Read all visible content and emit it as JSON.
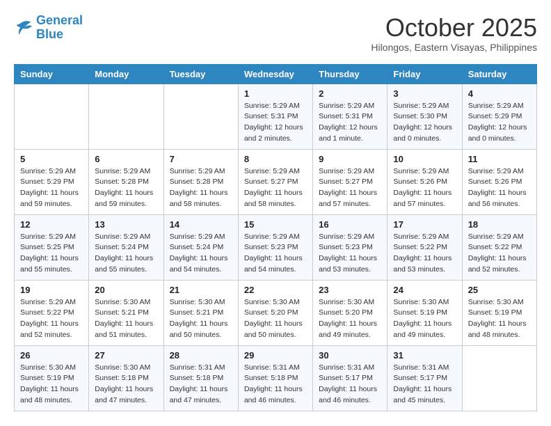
{
  "logo": {
    "line1": "General",
    "line2": "Blue"
  },
  "title": "October 2025",
  "location": "Hilongos, Eastern Visayas, Philippines",
  "days_of_week": [
    "Sunday",
    "Monday",
    "Tuesday",
    "Wednesday",
    "Thursday",
    "Friday",
    "Saturday"
  ],
  "weeks": [
    [
      {
        "day": "",
        "sunrise": "",
        "sunset": "",
        "daylight": ""
      },
      {
        "day": "",
        "sunrise": "",
        "sunset": "",
        "daylight": ""
      },
      {
        "day": "",
        "sunrise": "",
        "sunset": "",
        "daylight": ""
      },
      {
        "day": "1",
        "sunrise": "Sunrise: 5:29 AM",
        "sunset": "Sunset: 5:31 PM",
        "daylight": "Daylight: 12 hours and 2 minutes."
      },
      {
        "day": "2",
        "sunrise": "Sunrise: 5:29 AM",
        "sunset": "Sunset: 5:31 PM",
        "daylight": "Daylight: 12 hours and 1 minute."
      },
      {
        "day": "3",
        "sunrise": "Sunrise: 5:29 AM",
        "sunset": "Sunset: 5:30 PM",
        "daylight": "Daylight: 12 hours and 0 minutes."
      },
      {
        "day": "4",
        "sunrise": "Sunrise: 5:29 AM",
        "sunset": "Sunset: 5:29 PM",
        "daylight": "Daylight: 12 hours and 0 minutes."
      }
    ],
    [
      {
        "day": "5",
        "sunrise": "Sunrise: 5:29 AM",
        "sunset": "Sunset: 5:29 PM",
        "daylight": "Daylight: 11 hours and 59 minutes."
      },
      {
        "day": "6",
        "sunrise": "Sunrise: 5:29 AM",
        "sunset": "Sunset: 5:28 PM",
        "daylight": "Daylight: 11 hours and 59 minutes."
      },
      {
        "day": "7",
        "sunrise": "Sunrise: 5:29 AM",
        "sunset": "Sunset: 5:28 PM",
        "daylight": "Daylight: 11 hours and 58 minutes."
      },
      {
        "day": "8",
        "sunrise": "Sunrise: 5:29 AM",
        "sunset": "Sunset: 5:27 PM",
        "daylight": "Daylight: 11 hours and 58 minutes."
      },
      {
        "day": "9",
        "sunrise": "Sunrise: 5:29 AM",
        "sunset": "Sunset: 5:27 PM",
        "daylight": "Daylight: 11 hours and 57 minutes."
      },
      {
        "day": "10",
        "sunrise": "Sunrise: 5:29 AM",
        "sunset": "Sunset: 5:26 PM",
        "daylight": "Daylight: 11 hours and 57 minutes."
      },
      {
        "day": "11",
        "sunrise": "Sunrise: 5:29 AM",
        "sunset": "Sunset: 5:26 PM",
        "daylight": "Daylight: 11 hours and 56 minutes."
      }
    ],
    [
      {
        "day": "12",
        "sunrise": "Sunrise: 5:29 AM",
        "sunset": "Sunset: 5:25 PM",
        "daylight": "Daylight: 11 hours and 55 minutes."
      },
      {
        "day": "13",
        "sunrise": "Sunrise: 5:29 AM",
        "sunset": "Sunset: 5:24 PM",
        "daylight": "Daylight: 11 hours and 55 minutes."
      },
      {
        "day": "14",
        "sunrise": "Sunrise: 5:29 AM",
        "sunset": "Sunset: 5:24 PM",
        "daylight": "Daylight: 11 hours and 54 minutes."
      },
      {
        "day": "15",
        "sunrise": "Sunrise: 5:29 AM",
        "sunset": "Sunset: 5:23 PM",
        "daylight": "Daylight: 11 hours and 54 minutes."
      },
      {
        "day": "16",
        "sunrise": "Sunrise: 5:29 AM",
        "sunset": "Sunset: 5:23 PM",
        "daylight": "Daylight: 11 hours and 53 minutes."
      },
      {
        "day": "17",
        "sunrise": "Sunrise: 5:29 AM",
        "sunset": "Sunset: 5:22 PM",
        "daylight": "Daylight: 11 hours and 53 minutes."
      },
      {
        "day": "18",
        "sunrise": "Sunrise: 5:29 AM",
        "sunset": "Sunset: 5:22 PM",
        "daylight": "Daylight: 11 hours and 52 minutes."
      }
    ],
    [
      {
        "day": "19",
        "sunrise": "Sunrise: 5:29 AM",
        "sunset": "Sunset: 5:22 PM",
        "daylight": "Daylight: 11 hours and 52 minutes."
      },
      {
        "day": "20",
        "sunrise": "Sunrise: 5:30 AM",
        "sunset": "Sunset: 5:21 PM",
        "daylight": "Daylight: 11 hours and 51 minutes."
      },
      {
        "day": "21",
        "sunrise": "Sunrise: 5:30 AM",
        "sunset": "Sunset: 5:21 PM",
        "daylight": "Daylight: 11 hours and 50 minutes."
      },
      {
        "day": "22",
        "sunrise": "Sunrise: 5:30 AM",
        "sunset": "Sunset: 5:20 PM",
        "daylight": "Daylight: 11 hours and 50 minutes."
      },
      {
        "day": "23",
        "sunrise": "Sunrise: 5:30 AM",
        "sunset": "Sunset: 5:20 PM",
        "daylight": "Daylight: 11 hours and 49 minutes."
      },
      {
        "day": "24",
        "sunrise": "Sunrise: 5:30 AM",
        "sunset": "Sunset: 5:19 PM",
        "daylight": "Daylight: 11 hours and 49 minutes."
      },
      {
        "day": "25",
        "sunrise": "Sunrise: 5:30 AM",
        "sunset": "Sunset: 5:19 PM",
        "daylight": "Daylight: 11 hours and 48 minutes."
      }
    ],
    [
      {
        "day": "26",
        "sunrise": "Sunrise: 5:30 AM",
        "sunset": "Sunset: 5:19 PM",
        "daylight": "Daylight: 11 hours and 48 minutes."
      },
      {
        "day": "27",
        "sunrise": "Sunrise: 5:30 AM",
        "sunset": "Sunset: 5:18 PM",
        "daylight": "Daylight: 11 hours and 47 minutes."
      },
      {
        "day": "28",
        "sunrise": "Sunrise: 5:31 AM",
        "sunset": "Sunset: 5:18 PM",
        "daylight": "Daylight: 11 hours and 47 minutes."
      },
      {
        "day": "29",
        "sunrise": "Sunrise: 5:31 AM",
        "sunset": "Sunset: 5:18 PM",
        "daylight": "Daylight: 11 hours and 46 minutes."
      },
      {
        "day": "30",
        "sunrise": "Sunrise: 5:31 AM",
        "sunset": "Sunset: 5:17 PM",
        "daylight": "Daylight: 11 hours and 46 minutes."
      },
      {
        "day": "31",
        "sunrise": "Sunrise: 5:31 AM",
        "sunset": "Sunset: 5:17 PM",
        "daylight": "Daylight: 11 hours and 45 minutes."
      },
      {
        "day": "",
        "sunrise": "",
        "sunset": "",
        "daylight": ""
      }
    ]
  ]
}
